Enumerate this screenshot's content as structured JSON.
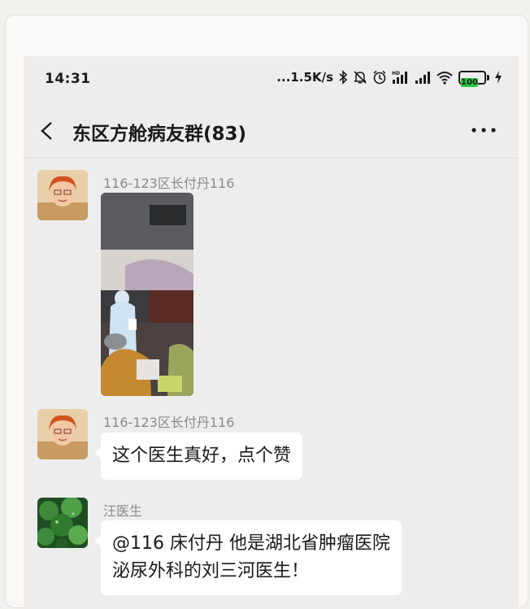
{
  "status_bar": {
    "time": "14:31",
    "network_speed": "...1.5K/s",
    "icons": [
      "bluetooth-icon",
      "mute-icon",
      "alarm-icon",
      "hd-signal-icon",
      "signal-icon",
      "wifi-icon",
      "battery-icon",
      "charging-icon"
    ],
    "battery_level": "100"
  },
  "header": {
    "back_icon": "chevron-left-icon",
    "title": "东区方舱病友群(83)",
    "more_icon": "more-dots-icon"
  },
  "messages": [
    {
      "sender": "116-123区长付丹116",
      "type": "image",
      "image": "doctor-in-protective-suit-photo"
    },
    {
      "sender": "116-123区长付丹116",
      "type": "text",
      "lines": [
        "这个医生真好，点个赞"
      ]
    },
    {
      "sender": "汪医生",
      "type": "text",
      "lines": [
        "@116 床付丹  他是湖北省肿瘤医院",
        "泌尿外科的刘三河医生！"
      ]
    }
  ],
  "colors": {
    "background": "#ededed",
    "bubble": "#ffffff",
    "battery": "#28c840"
  }
}
